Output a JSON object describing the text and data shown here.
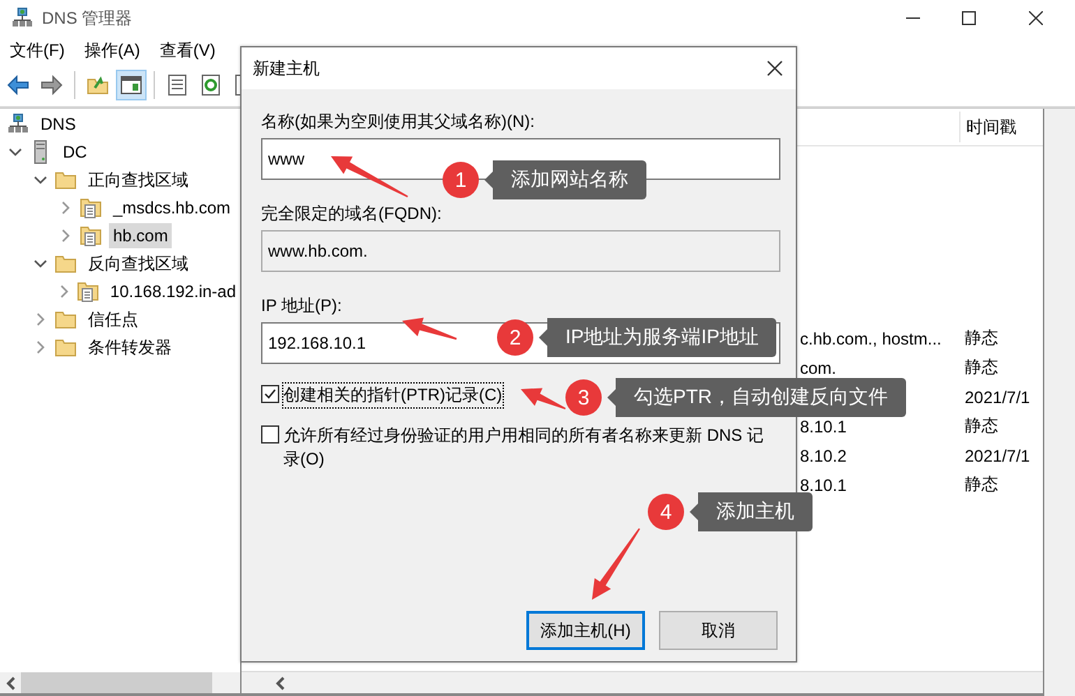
{
  "window": {
    "title": "DNS 管理器"
  },
  "menu": [
    "文件(F)",
    "操作(A)",
    "查看(V)"
  ],
  "toolbar": {
    "console_tree_shown": true
  },
  "tree": [
    {
      "label": "DNS",
      "kind": "dns",
      "selected": false,
      "children": [
        {
          "label": "DC",
          "kind": "server",
          "expanded": true,
          "selected": false,
          "children": [
            {
              "label": "正向查找区域",
              "kind": "folder",
              "expanded": true,
              "selected": false,
              "children": [
                {
                  "label": "_msdcs.hb.com",
                  "kind": "zone",
                  "expanded": false,
                  "selected": false
                },
                {
                  "label": "hb.com",
                  "kind": "zone",
                  "expanded": false,
                  "selected": true
                }
              ]
            },
            {
              "label": "反向查找区域",
              "kind": "folder",
              "expanded": true,
              "selected": false,
              "children": [
                {
                  "label": "10.168.192.in-ad",
                  "kind": "zone",
                  "expanded": false,
                  "selected": false
                }
              ]
            },
            {
              "label": "信任点",
              "kind": "folder",
              "expanded": false,
              "selected": false
            },
            {
              "label": "条件转发器",
              "kind": "folder",
              "expanded": false,
              "selected": false
            }
          ]
        }
      ]
    }
  ],
  "list": {
    "timestamp_header": "时间戳",
    "rows": [
      {
        "column_1": "c.hb.com., hostm...",
        "timestamp": "静态"
      },
      {
        "column_1": "com.",
        "timestamp": "静态"
      },
      {
        "timestamp": "2021/7/1"
      },
      {
        "column_1": "8.10.1",
        "timestamp": "静态"
      },
      {
        "column_1": "8.10.2",
        "timestamp": "2021/7/1"
      },
      {
        "column_1": "8.10.1",
        "timestamp": "静态"
      }
    ]
  },
  "dialog": {
    "title": "新建主机",
    "fields": [
      {
        "label": "名称(如果为空则使用其父域名称)(N):",
        "value": "www",
        "readonly": false
      },
      {
        "label": "完全限定的域名(FQDN):",
        "value": "www.hb.com.",
        "readonly": true
      },
      {
        "label": "IP 地址(P):",
        "value": "192.168.10.1",
        "readonly": false
      }
    ],
    "checkboxes": [
      {
        "label": "创建相关的指针(PTR)记录(C)",
        "checked": true,
        "focused": true
      },
      {
        "label": "允许所有经过身份验证的用户用相同的所有者名称来更新 DNS 记录(O)",
        "checked": false,
        "focused": false
      }
    ],
    "buttons": [
      {
        "label": "添加主机(H)",
        "default": true
      },
      {
        "label": "取消",
        "default": false
      }
    ]
  },
  "annotations": [
    {
      "number": "1",
      "text": "添加网站名称"
    },
    {
      "number": "2",
      "text": "IP地址为服务端IP地址"
    },
    {
      "number": "3",
      "text": "勾选PTR，自动创建反向文件"
    },
    {
      "number": "4",
      "text": "添加主机"
    }
  ]
}
